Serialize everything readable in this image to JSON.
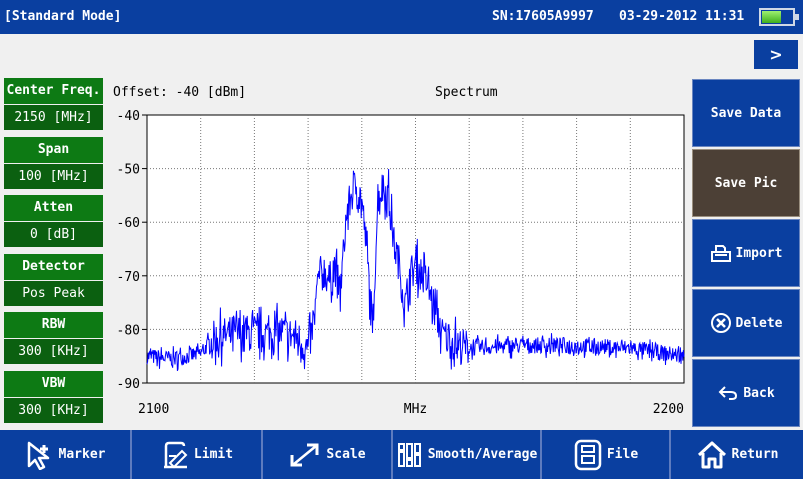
{
  "status_bar": {
    "mode": "[Standard Mode]",
    "serial": "SN:17605A9997",
    "datetime": "03-29-2012 11:31",
    "battery_level": 0.6
  },
  "nav": {
    "next_icon": "chevron-right-icon",
    "next_label": ">"
  },
  "parameters": [
    {
      "label": "Center Freq.",
      "value": "2150 [MHz]"
    },
    {
      "label": "Span",
      "value": "100 [MHz]"
    },
    {
      "label": "Atten",
      "value": "0 [dB]"
    },
    {
      "label": "Detector",
      "value": "Pos Peak"
    },
    {
      "label": "RBW",
      "value": "300 [KHz]"
    },
    {
      "label": "VBW",
      "value": "300 [KHz]"
    }
  ],
  "chart_header": {
    "offset": "Offset: -40 [dBm]",
    "title": "Spectrum"
  },
  "right_actions": [
    {
      "label": "Save Data",
      "icon": ""
    },
    {
      "label": "Save Pic",
      "icon": "",
      "active": true
    },
    {
      "label": "Import",
      "icon": "import-icon"
    },
    {
      "label": "Delete",
      "icon": "delete-icon"
    },
    {
      "label": "Back",
      "icon": "back-arrow-icon"
    }
  ],
  "bottom_actions": [
    {
      "label": "Marker",
      "icon": "marker-icon"
    },
    {
      "label": "Limit",
      "icon": "limit-icon"
    },
    {
      "label": "Scale",
      "icon": "scale-icon"
    },
    {
      "label": "Smooth/Average",
      "icon": "smooth-icon"
    },
    {
      "label": "File",
      "icon": "file-icon"
    },
    {
      "label": "Return",
      "icon": "home-icon"
    }
  ],
  "colors": {
    "bar": "#0a3fa0",
    "param_label": "#0d7a14",
    "param_value": "#0b6010",
    "trace": "#0000ff",
    "active_button": "#4c4036"
  },
  "chart_data": {
    "type": "line",
    "title": "Spectrum",
    "xlabel": "MHz",
    "ylabel": "",
    "xlim": [
      2100,
      2200
    ],
    "ylim": [
      -90,
      -40
    ],
    "x_ticks": [
      "2100",
      "2200"
    ],
    "y_ticks": [
      "-40",
      "-50",
      "-60",
      "-70",
      "-80",
      "-90"
    ],
    "grid": true,
    "series": [
      {
        "x": [
          2100,
          2105,
          2110,
          2112,
          2115,
          2118,
          2120,
          2125,
          2128,
          2130,
          2131,
          2132,
          2133,
          2134,
          2135,
          2136,
          2137,
          2138,
          2139,
          2140,
          2141,
          2142,
          2143,
          2144,
          2145,
          2146,
          2147,
          2148,
          2149,
          2150,
          2152,
          2155,
          2158,
          2160,
          2170,
          2180,
          2190,
          2200
        ],
        "values": [
          -85,
          -85.5,
          -84.5,
          -82,
          -81,
          -80.5,
          -81,
          -80.5,
          -81.5,
          -84,
          -79,
          -70,
          -69,
          -71,
          -68,
          -74,
          -60,
          -55,
          -53,
          -56,
          -66,
          -81,
          -55,
          -53.5,
          -55,
          -64,
          -68,
          -76,
          -70,
          -68,
          -71,
          -81,
          -83,
          -83.5,
          -83,
          -83,
          -83.5,
          -85
        ]
      }
    ]
  }
}
